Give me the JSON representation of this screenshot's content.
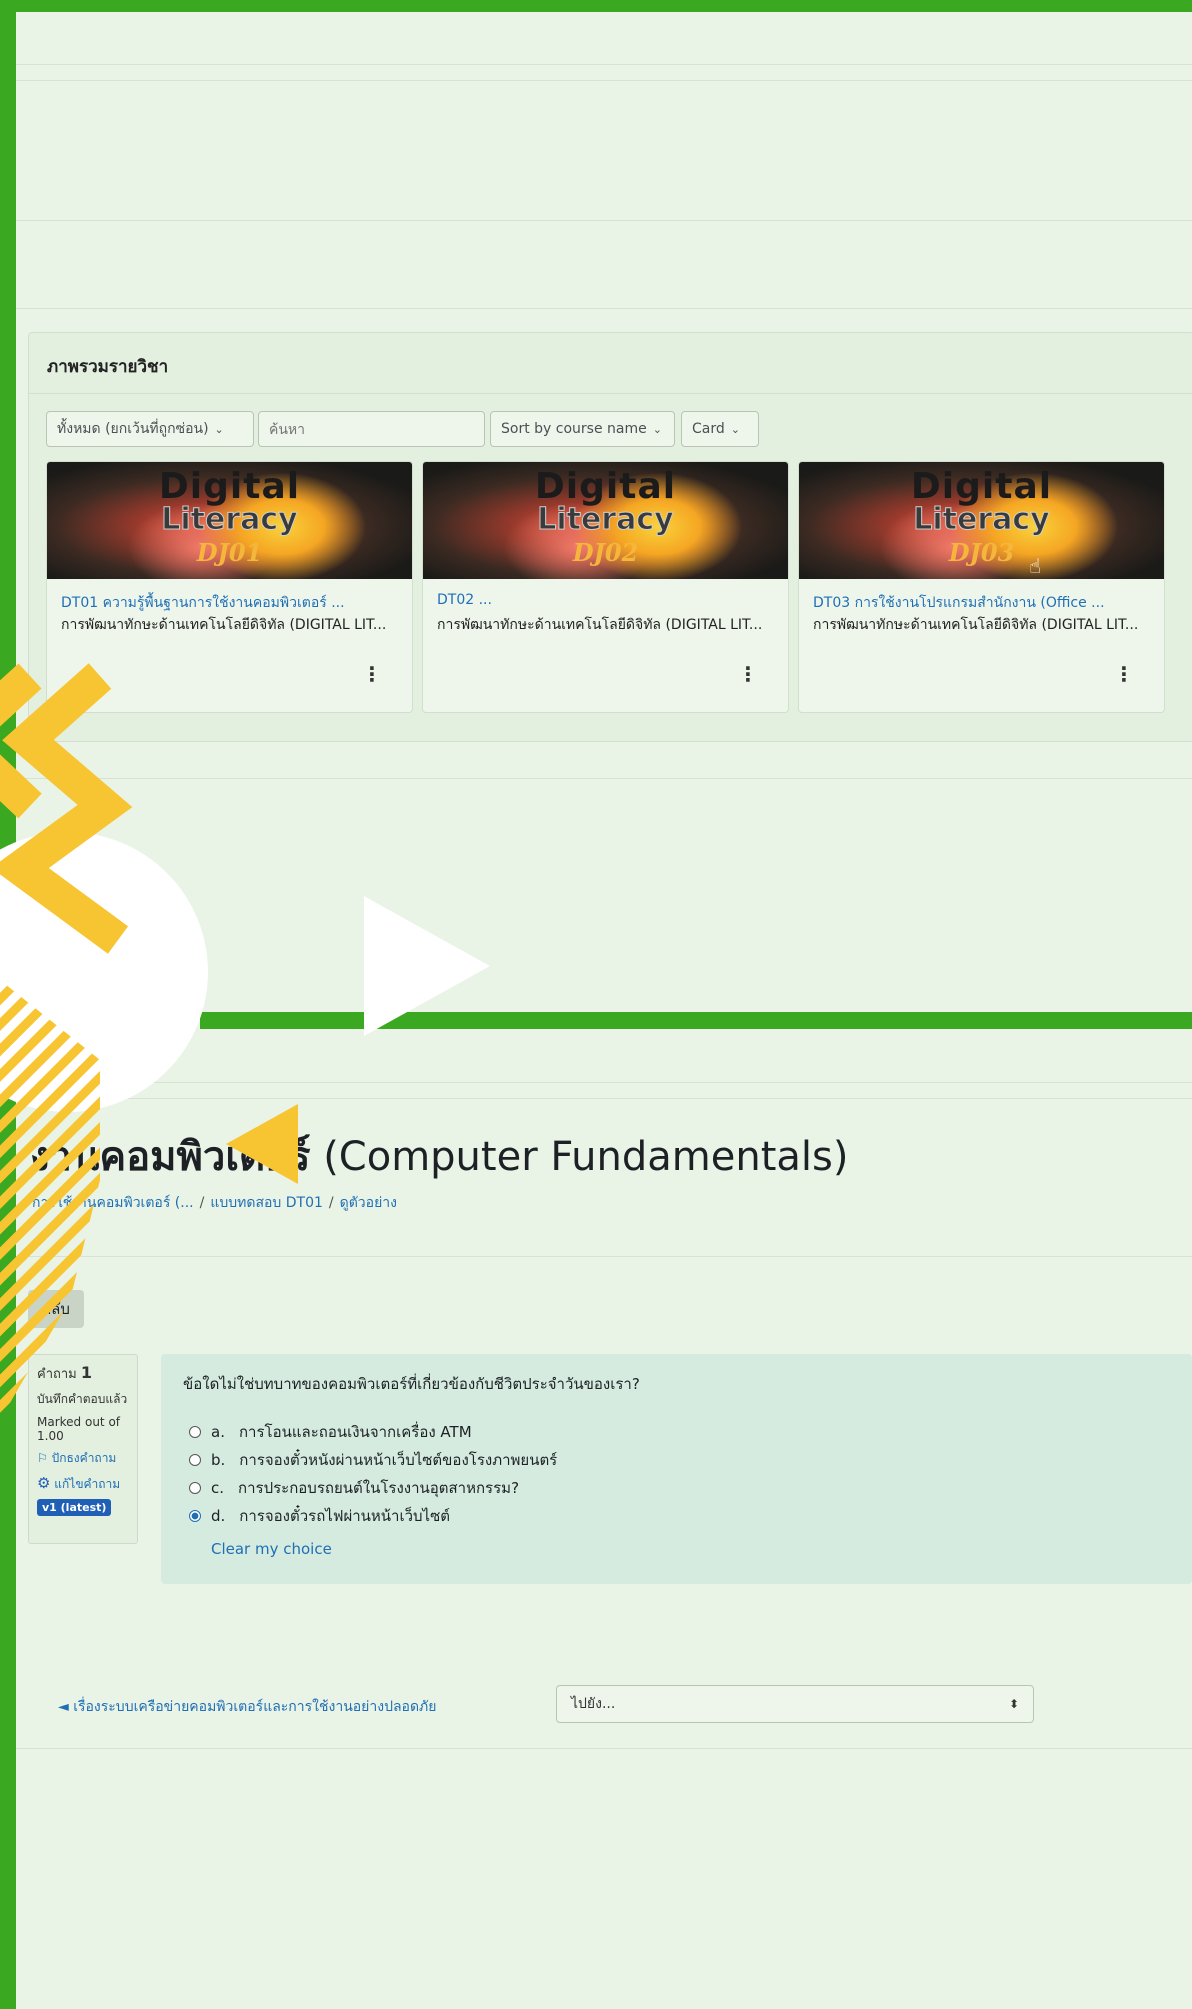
{
  "colors": {
    "frame_green": "#3aa820",
    "accent_yellow": "#f7c531",
    "link_blue": "#1f6fb5"
  },
  "overview": {
    "title": "ภาพรวมรายวิชา",
    "filter_label": "ทั้งหมด (ยกเว้นที่ถูกซ่อน)",
    "search_placeholder": "ค้นหา",
    "sort_label": "Sort by course name",
    "view_label": "Card"
  },
  "courses": [
    {
      "art_line1": "Digital",
      "art_line2": "Literacy",
      "art_code": "DJ01",
      "name": "DT01 ความรู้พื้นฐานการใช้งานคอมพิวเตอร์ ...",
      "category": "การพัฒนาทักษะด้านเทคโนโลยีดิจิทัล (DIGITAL LIT..."
    },
    {
      "art_line1": "Digital",
      "art_line2": "Literacy",
      "art_code": "DJ02",
      "name": "DT02 ...",
      "category": "การพัฒนาทักษะด้านเทคโนโลยีดิจิทัล (DIGITAL LIT..."
    },
    {
      "art_line1": "Digital",
      "art_line2": "Literacy",
      "art_code": "DJ03",
      "name": "DT03 การใช้งานโปรแกรมสำนักงาน (Office ...",
      "category": "การพัฒนาทักษะด้านเทคโนโลยีดิจิทัล (DIGITAL LIT..."
    }
  ],
  "quiz": {
    "title_thai": "งานคอมพิวเตอร์",
    "title_en": "(Computer Fundamentals)",
    "breadcrumb": [
      "การใช้งานคอมพิวเตอร์ (...",
      "แบบทดสอบ DT01",
      "ดูตัวอย่าง"
    ],
    "back_label": "กลับ",
    "info": {
      "question_label": "คำถาม",
      "question_number": "1",
      "status": "บันทึกคำตอบแล้ว",
      "marked": "Marked out of 1.00",
      "flag": "ปักธงคำถาม",
      "edit": "แก้ไขคำถาม",
      "version": "v1 (latest)"
    },
    "question_text": "ข้อใดไม่ใช่บทบาทของคอมพิวเตอร์ที่เกี่ยวข้องกับชีวิตประจำวันของเรา?",
    "options": [
      {
        "letter": "a.",
        "text": "การโอนและถอนเงินจากเครื่อง ATM",
        "selected": false
      },
      {
        "letter": "b.",
        "text": "การจองตั๋วหนังผ่านหน้าเว็บไซต์ของโรงภาพยนตร์",
        "selected": false
      },
      {
        "letter": "c.",
        "text": "การประกอบรถยนต์ในโรงงานอุตสาหกรรม?",
        "selected": false
      },
      {
        "letter": "d.",
        "text": "การจองตั๋วรถไฟผ่านหน้าเว็บไซต์",
        "selected": true
      }
    ],
    "clear_label": "Clear my choice",
    "prev_link": "◄ เรื่องระบบเครือข่ายคอมพิวเตอร์และการใช้งานอย่างปลอดภัย",
    "jump_label": "ไปยัง..."
  }
}
